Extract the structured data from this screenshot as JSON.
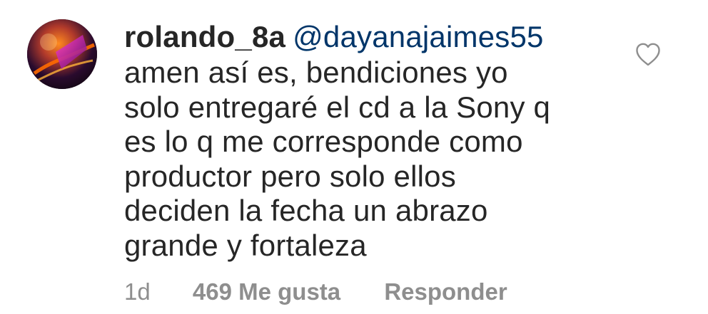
{
  "comment": {
    "username": "rolando_8a",
    "mention": "@dayanajaimes55",
    "lines": [
      "amen así es, bendiciones yo",
      "solo entregaré el cd a la Sony q",
      "es lo q me corresponde como",
      "productor pero solo ellos",
      "deciden la fecha un abrazo",
      "grande y fortaleza"
    ],
    "meta": {
      "time": "1d",
      "likes": "469 Me gusta",
      "reply": "Responder"
    }
  },
  "icons": {
    "like": "heart-outline-icon",
    "avatar": "avatar"
  },
  "colors": {
    "text": "#262626",
    "mention": "#003569",
    "meta": "#8e8e8e",
    "background": "#ffffff"
  }
}
